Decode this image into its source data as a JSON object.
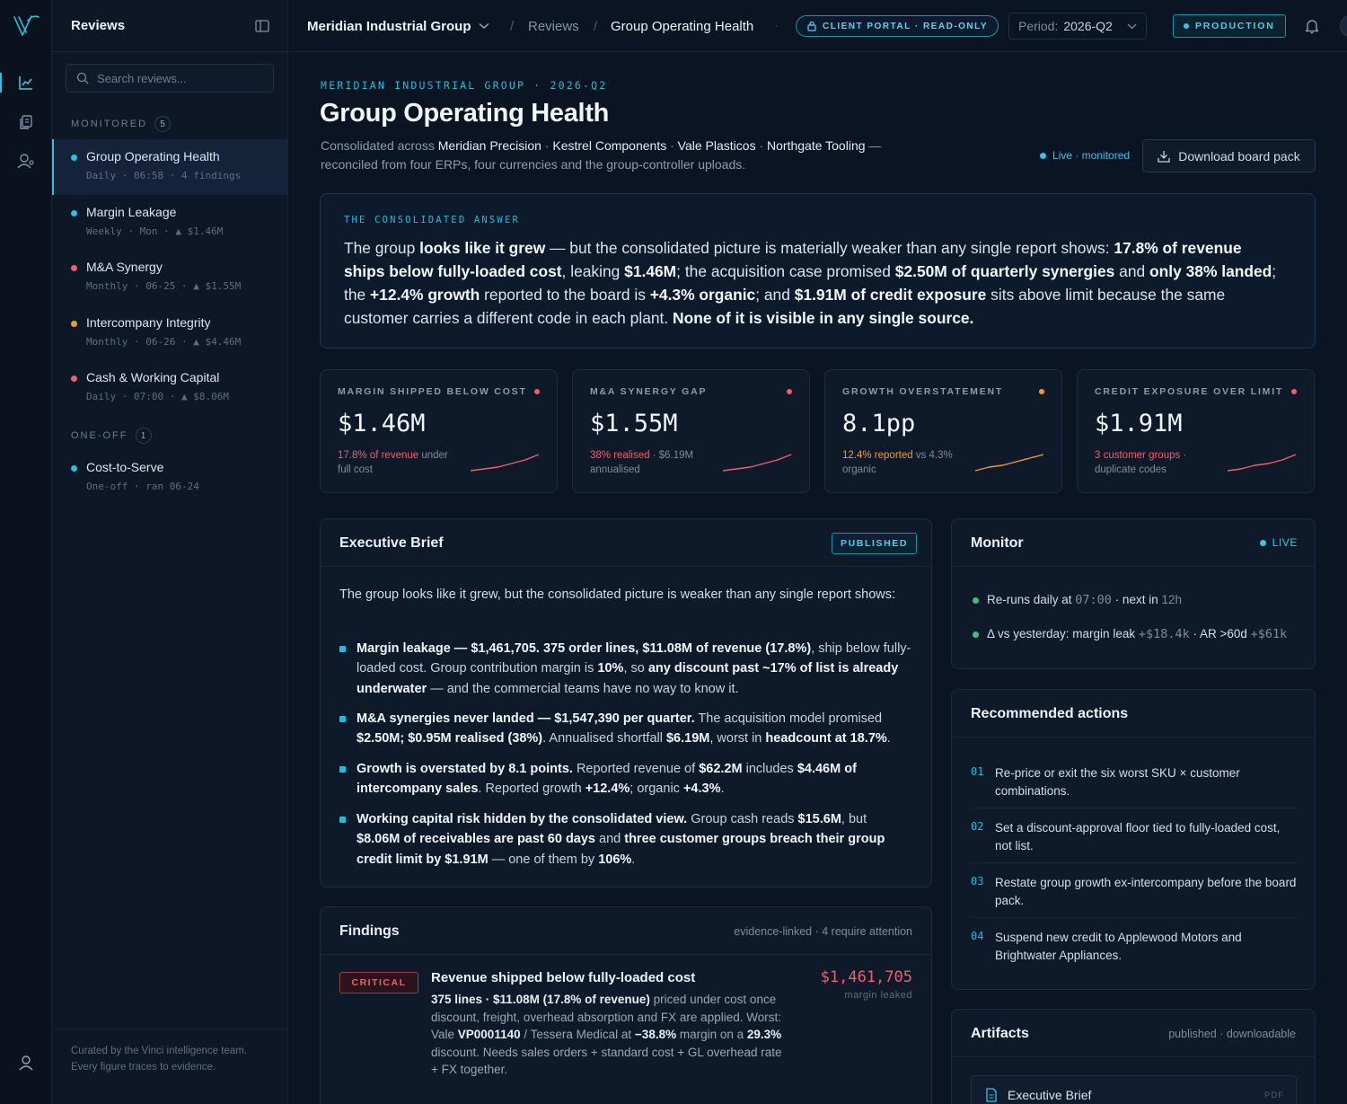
{
  "sidebar": {
    "title": "Reviews",
    "search_placeholder": "Search reviews...",
    "groups": [
      {
        "label": "MONITORED",
        "count": "5"
      },
      {
        "label": "ONE-OFF",
        "count": "1"
      }
    ],
    "items": [
      {
        "name": "Group Operating Health",
        "meta": "Daily · 06:58 · 4 findings",
        "status_color": "#22c3e6"
      },
      {
        "name": "Margin Leakage",
        "meta": "Weekly · Mon · ▲ $1.46M",
        "status_color": "#22c3e6"
      },
      {
        "name": "M&A Synergy",
        "meta": "Monthly · 06-25 · ▲ $1.55M",
        "status_color": "#ef5f69"
      },
      {
        "name": "Intercompany Integrity",
        "meta": "Monthly · 06-26 · ▲ $4.46M",
        "status_color": "#f29a2e"
      },
      {
        "name": "Cash & Working Capital",
        "meta": "Daily · 07:00 · ▲ $8.06M",
        "status_color": "#ef5f69"
      },
      {
        "name": "Cost-to-Serve",
        "meta": "One-off · ran 06-24",
        "status_color": "#22c3e6"
      }
    ],
    "footer": "Curated by the Vinci intelligence team. Every figure traces to evidence."
  },
  "topbar": {
    "org": "Meridian Industrial Group",
    "crumb": "Reviews",
    "current": "Group Operating Health",
    "portal_badge": "CLIENT PORTAL · READ-ONLY",
    "period_label": "Period:",
    "period_value": "2026-Q2",
    "env_badge": "PRODUCTION"
  },
  "header": {
    "eyebrow": "MERIDIAN INDUSTRIAL GROUP · 2026-Q2",
    "title": "Group Operating Health",
    "subtitle_prefix": "Consolidated across",
    "entities": [
      "Meridian Precision",
      "Kestrel Components",
      "Vale Plasticos",
      "Northgate Tooling"
    ],
    "subtitle_dash": "—",
    "subtitle_suffix": "reconciled from four ERPs, four currencies and the group-controller uploads.",
    "live_status": "Live · monitored",
    "download_label": "Download board pack"
  },
  "answer": {
    "label": "THE CONSOLIDATED ANSWER",
    "segments": [
      {
        "t": "The group ",
        "b": false
      },
      {
        "t": "looks like it grew",
        "b": true
      },
      {
        "t": " — but the consolidated picture is materially weaker than any single report shows: ",
        "b": false
      },
      {
        "t": "17.8% of revenue ships below fully-loaded cost",
        "b": true
      },
      {
        "t": ", leaking ",
        "b": false
      },
      {
        "t": "$1.46M",
        "b": true
      },
      {
        "t": "; the acquisition case promised ",
        "b": false
      },
      {
        "t": "$2.50M of quarterly synergies",
        "b": true
      },
      {
        "t": " and ",
        "b": false
      },
      {
        "t": "only 38% landed",
        "b": true
      },
      {
        "t": "; the ",
        "b": false
      },
      {
        "t": "+12.4% growth",
        "b": true
      },
      {
        "t": " reported to the board is ",
        "b": false
      },
      {
        "t": "+4.3% organic",
        "b": true
      },
      {
        "t": "; and ",
        "b": false
      },
      {
        "t": "$1.91M of credit exposure",
        "b": true
      },
      {
        "t": " sits above limit because the same customer carries a different code in each plant. ",
        "b": false
      },
      {
        "t": "None of it is visible in any single source.",
        "b": true
      }
    ]
  },
  "kpis": [
    {
      "label": "MARGIN SHIPPED BELOW COST",
      "value": "$1.46M",
      "accent": "17.8% of revenue",
      "rest": " under full cost",
      "color": "#ef5f69",
      "trend": [
        1,
        2,
        3,
        5,
        7,
        10
      ]
    },
    {
      "label": "M&A SYNERGY GAP",
      "value": "$1.55M",
      "accent": "38% realised",
      "rest": " · $6.19M annualised",
      "color": "#ef5f69",
      "trend": [
        1,
        2,
        3,
        5,
        7,
        10
      ]
    },
    {
      "label": "GROWTH OVERSTATEMENT",
      "value": "8.1pp",
      "accent": "12.4% reported",
      "rest": " vs 4.3% organic",
      "color": "#f29a2e",
      "trend": [
        1,
        3,
        4,
        6,
        8,
        10
      ]
    },
    {
      "label": "CREDIT EXPOSURE OVER LIMIT",
      "value": "$1.91M",
      "accent": "3 customer groups",
      "rest": " · duplicate codes",
      "color": "#ef5f69",
      "trend": [
        1,
        2,
        4,
        5,
        7,
        10
      ]
    }
  ],
  "brief": {
    "title": "Executive Brief",
    "badge": "PUBLISHED",
    "intro": "The group looks like it grew, but the consolidated picture is weaker than any single report shows:",
    "bullets": [
      [
        {
          "t": "Margin leakage — $1,461,705. 375 order lines, $11.08M of revenue (17.8%)",
          "b": true
        },
        {
          "t": ", ship below fully-loaded cost. Group contribution margin is ",
          "b": false
        },
        {
          "t": "10%",
          "b": true
        },
        {
          "t": ", so ",
          "b": false
        },
        {
          "t": "any discount past ~17% of list is already underwater",
          "b": true
        },
        {
          "t": " — and the commercial teams have no way to know it.",
          "b": false
        }
      ],
      [
        {
          "t": "M&A synergies never landed — $1,547,390 per quarter.",
          "b": true
        },
        {
          "t": " The acquisition model promised ",
          "b": false
        },
        {
          "t": "$2.50M; $0.95M realised (38%)",
          "b": true
        },
        {
          "t": ". Annualised shortfall ",
          "b": false
        },
        {
          "t": "$6.19M",
          "b": true
        },
        {
          "t": ", worst in ",
          "b": false
        },
        {
          "t": "headcount at 18.7%",
          "b": true
        },
        {
          "t": ".",
          "b": false
        }
      ],
      [
        {
          "t": "Growth is overstated by 8.1 points.",
          "b": true
        },
        {
          "t": " Reported revenue of ",
          "b": false
        },
        {
          "t": "$62.2M",
          "b": true
        },
        {
          "t": " includes ",
          "b": false
        },
        {
          "t": "$4.46M of intercompany sales",
          "b": true
        },
        {
          "t": ". Reported growth ",
          "b": false
        },
        {
          "t": "+12.4%",
          "b": true
        },
        {
          "t": "; organic ",
          "b": false
        },
        {
          "t": "+4.3%",
          "b": true
        },
        {
          "t": ".",
          "b": false
        }
      ],
      [
        {
          "t": "Working capital risk hidden by the consolidated view.",
          "b": true
        },
        {
          "t": " Group cash reads ",
          "b": false
        },
        {
          "t": "$15.6M",
          "b": true
        },
        {
          "t": ", but ",
          "b": false
        },
        {
          "t": "$8.06M of receivables are past 60 days",
          "b": true
        },
        {
          "t": " and ",
          "b": false
        },
        {
          "t": "three customer groups breach their group credit limit by $1.91M",
          "b": true
        },
        {
          "t": " — one of them by ",
          "b": false
        },
        {
          "t": "106%",
          "b": true
        },
        {
          "t": ".",
          "b": false
        }
      ]
    ]
  },
  "findings": {
    "title": "Findings",
    "meta": "evidence-linked · 4 require attention",
    "items": [
      {
        "severity": "CRITICAL",
        "title": "Revenue shipped below fully-loaded cost",
        "amount": "$1,461,705",
        "amount_label": "margin leaked",
        "body": [
          {
            "t": "375 lines · $11.08M (17.8% of revenue)",
            "b": true
          },
          {
            "t": " priced under cost once discount, freight, overhead absorption and FX are applied. Worst: Vale ",
            "b": false
          },
          {
            "t": "VP0001140",
            "b": true
          },
          {
            "t": " / Tessera Medical at ",
            "b": false
          },
          {
            "t": "−38.8%",
            "b": true
          },
          {
            "t": " margin on a ",
            "b": false
          },
          {
            "t": "29.3%",
            "b": true
          },
          {
            "t": " discount. Needs sales orders + standard cost + GL overhead rate + FX together.",
            "b": false
          }
        ]
      }
    ]
  },
  "monitor": {
    "title": "Monitor",
    "status": "LIVE",
    "row1": {
      "a": "Re-runs daily at ",
      "time": "07:00",
      "b": " · next in ",
      "next": "12h"
    },
    "row2": {
      "a": "Δ vs yesterday: margin leak ",
      "d1": "+$18.4k",
      "b": " · AR >60d ",
      "d2": "+$61k"
    }
  },
  "actions": {
    "title": "Recommended actions",
    "items": [
      {
        "n": "01",
        "t": "Re-price or exit the six worst SKU × customer combinations."
      },
      {
        "n": "02",
        "t": "Set a discount-approval floor tied to fully-loaded cost, not list."
      },
      {
        "n": "03",
        "t": "Restate group growth ex-intercompany before the board pack."
      },
      {
        "n": "04",
        "t": "Suspend new credit to Applewood Motors and Brightwater Appliances."
      }
    ]
  },
  "artifacts": {
    "title": "Artifacts",
    "meta": "published · downloadable",
    "items": [
      {
        "name": "Executive Brief",
        "type": "PDF"
      }
    ]
  },
  "theme": {
    "accent": "#22c3e6",
    "critical": "#ef5f69",
    "warning": "#f29a2e",
    "ok": "#2fc57d"
  }
}
